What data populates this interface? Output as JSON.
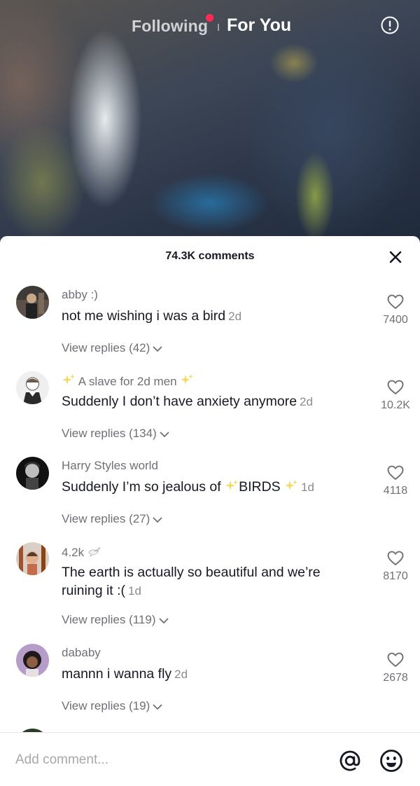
{
  "top_nav": {
    "following_label": "Following",
    "for_you_label": "For You",
    "live_dot_color": "#fe2c55"
  },
  "comments_sheet": {
    "count_label": "74.3K comments",
    "comments": [
      {
        "username": "abby :)",
        "text": "not me wishing i was a bird",
        "time": "2d",
        "likes": "7400",
        "replies_label": "View replies (42)"
      },
      {
        "username": "A slave for 2d men",
        "text": "Suddenly I don’t have anxiety anymore",
        "time": "2d",
        "likes": "10.2K",
        "replies_label": "View replies (134)"
      },
      {
        "username": "Harry Styles world",
        "text_before": "Suddenly I’m so jealous of ",
        "text_highlight": "BIRDS",
        "time": "1d",
        "likes": "4118",
        "replies_label": "View replies (27)"
      },
      {
        "username": "4.2k",
        "text": "The earth is actually so beautiful and we’re ruining it :(",
        "time": "1d",
        "likes": "8170",
        "replies_label": "View replies (119)"
      },
      {
        "username": "dababy",
        "text": "mannn i wanna fly",
        "time": "2d",
        "likes": "2678",
        "replies_label": "View replies (19)"
      }
    ]
  },
  "bottom_bar": {
    "input_placeholder": "Add comment..."
  },
  "icons": {
    "alert": "alert-circle-icon",
    "close": "close-icon",
    "heart": "heart-outline-icon",
    "chevron": "chevron-down-icon",
    "sparkle": "sparkles-emoji-icon",
    "dove": "dove-emoji-icon",
    "mention": "at-sign-icon",
    "emoji": "smiley-face-icon"
  }
}
